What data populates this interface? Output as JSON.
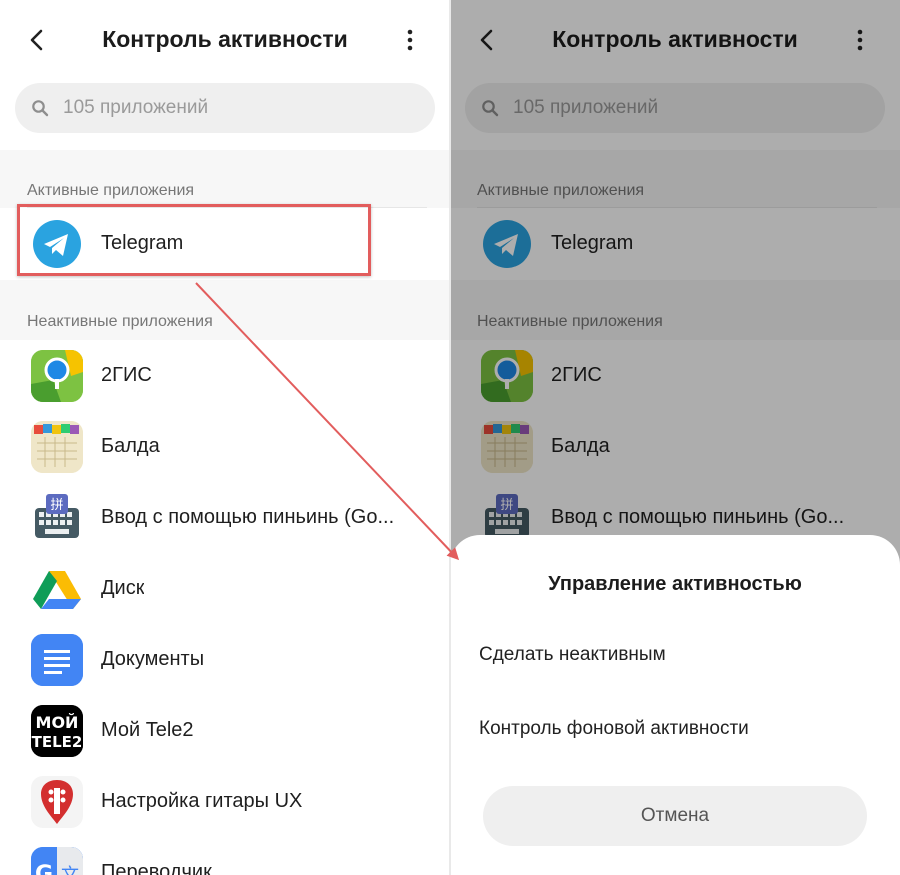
{
  "left": {
    "title": "Контроль активности",
    "search_placeholder": "105 приложений",
    "active_section": "Активные приложения",
    "inactive_section": "Неактивные приложения",
    "active_apps": [
      {
        "name": "Telegram",
        "icon": "telegram-icon"
      }
    ],
    "inactive_apps": [
      {
        "name": "2ГИС",
        "icon": "2gis-icon"
      },
      {
        "name": "Балда",
        "icon": "balda-icon"
      },
      {
        "name": "Ввод с помощью пиньинь (Go...",
        "icon": "pinyin-keyboard-icon"
      },
      {
        "name": "Диск",
        "icon": "google-drive-icon"
      },
      {
        "name": "Документы",
        "icon": "google-docs-icon"
      },
      {
        "name": "Мой Tele2",
        "icon": "tele2-icon"
      },
      {
        "name": "Настройка гитары UX",
        "icon": "guitar-tuner-icon"
      },
      {
        "name": "Переводчик",
        "icon": "google-translate-icon"
      }
    ]
  },
  "right": {
    "title": "Контроль активности",
    "search_placeholder": "105 приложений",
    "active_section": "Активные приложения",
    "inactive_section": "Неактивные приложения",
    "active_apps": [
      {
        "name": "Telegram",
        "icon": "telegram-icon"
      }
    ],
    "inactive_apps": [
      {
        "name": "2ГИС",
        "icon": "2gis-icon"
      },
      {
        "name": "Балда",
        "icon": "balda-icon"
      },
      {
        "name": "Ввод с помощью пиньинь (Go...",
        "icon": "pinyin-keyboard-icon"
      }
    ],
    "dialog": {
      "title": "Управление активностью",
      "option_make_inactive": "Сделать неактивным",
      "option_background_control": "Контроль фоновой активности",
      "cancel": "Отмена"
    }
  },
  "colors": {
    "highlight": "#e25d5d",
    "telegram": "#2aa3e0",
    "overlay": "rgba(0,0,0,0.32)"
  }
}
